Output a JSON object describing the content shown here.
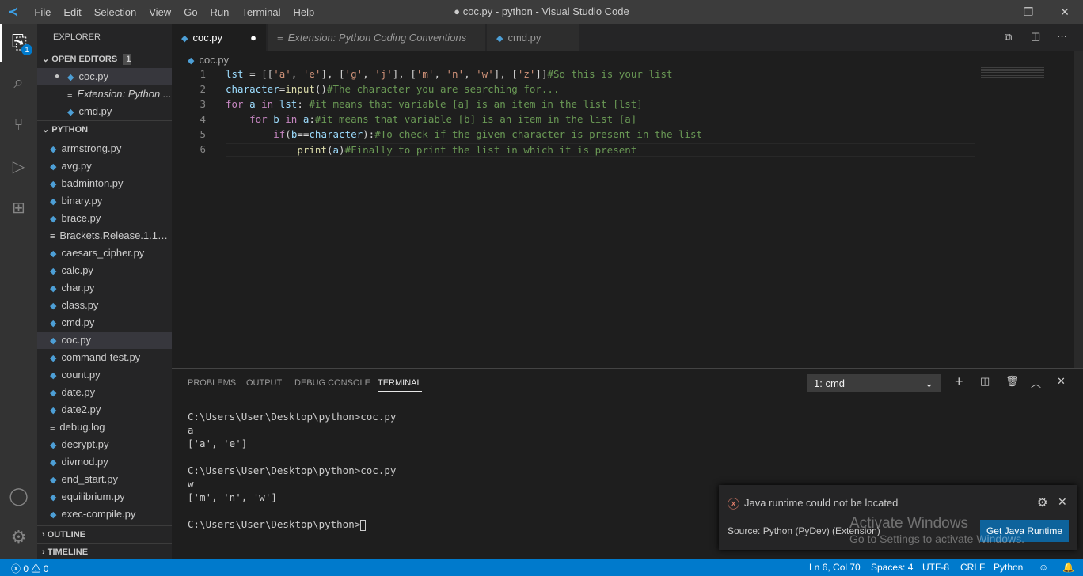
{
  "titlebar": {
    "menus": [
      "File",
      "Edit",
      "Selection",
      "View",
      "Go",
      "Run",
      "Terminal",
      "Help"
    ],
    "title": "● coc.py - python - Visual Studio Code"
  },
  "activity": {
    "explorer_badge": "1"
  },
  "sidebar": {
    "header": "EXPLORER",
    "open_editors": "OPEN EDITORS",
    "unsaved": "1 UNSAVED",
    "open_files": [
      {
        "name": "coc.py",
        "dirty": true,
        "type": "py"
      },
      {
        "name": "Extension: Python ...",
        "type": "ext"
      },
      {
        "name": "cmd.py",
        "type": "py"
      }
    ],
    "folder": "PYTHON",
    "files": [
      {
        "name": "armstrong.py",
        "type": "py"
      },
      {
        "name": "avg.py",
        "type": "py"
      },
      {
        "name": "badminton.py",
        "type": "py"
      },
      {
        "name": "binary.py",
        "type": "py"
      },
      {
        "name": "brace.py",
        "type": "py"
      },
      {
        "name": "Brackets.Release.1.14....",
        "type": "txt"
      },
      {
        "name": "caesars_cipher.py",
        "type": "py"
      },
      {
        "name": "calc.py",
        "type": "py"
      },
      {
        "name": "char.py",
        "type": "py"
      },
      {
        "name": "class.py",
        "type": "py"
      },
      {
        "name": "cmd.py",
        "type": "py"
      },
      {
        "name": "coc.py",
        "type": "py",
        "selected": true
      },
      {
        "name": "command-test.py",
        "type": "py"
      },
      {
        "name": "count.py",
        "type": "py"
      },
      {
        "name": "date.py",
        "type": "py"
      },
      {
        "name": "date2.py",
        "type": "py"
      },
      {
        "name": "debug.log",
        "type": "txt"
      },
      {
        "name": "decrypt.py",
        "type": "py"
      },
      {
        "name": "divmod.py",
        "type": "py"
      },
      {
        "name": "end_start.py",
        "type": "py"
      },
      {
        "name": "equilibrium.py",
        "type": "py"
      },
      {
        "name": "exec-compile.py",
        "type": "py"
      }
    ],
    "outline": "OUTLINE",
    "timeline": "TIMELINE"
  },
  "tabs": [
    {
      "label": "coc.py",
      "active": true,
      "dirty": true
    },
    {
      "label": "Extension: Python Coding Conventions",
      "italic": true
    },
    {
      "label": "cmd.py"
    }
  ],
  "breadcrumb": "coc.py",
  "colors": {
    "keyword": "#c586c0",
    "var": "#9cdcfe",
    "func": "#dcdcaa",
    "string": "#ce9178",
    "comment": "#6a9955",
    "plain": "#d4d4d4"
  },
  "code": [
    [
      [
        "lst",
        "var"
      ],
      [
        " = [[",
        "plain"
      ],
      [
        "'a'",
        "string"
      ],
      [
        ", ",
        "plain"
      ],
      [
        "'e'",
        "string"
      ],
      [
        "], [",
        "plain"
      ],
      [
        "'g'",
        "string"
      ],
      [
        ", ",
        "plain"
      ],
      [
        "'j'",
        "string"
      ],
      [
        "], [",
        "plain"
      ],
      [
        "'m'",
        "string"
      ],
      [
        ", ",
        "plain"
      ],
      [
        "'n'",
        "string"
      ],
      [
        ", ",
        "plain"
      ],
      [
        "'w'",
        "string"
      ],
      [
        "], [",
        "plain"
      ],
      [
        "'z'",
        "string"
      ],
      [
        "]]",
        "plain"
      ],
      [
        "#So this is your list",
        "comment"
      ]
    ],
    [
      [
        "character",
        "var"
      ],
      [
        "=",
        "plain"
      ],
      [
        "input",
        "func"
      ],
      [
        "()",
        "plain"
      ],
      [
        "#The character you are searching for...",
        "comment"
      ]
    ],
    [
      [
        "for",
        "keyword"
      ],
      [
        " a ",
        "var"
      ],
      [
        "in",
        "keyword"
      ],
      [
        " lst",
        "var"
      ],
      [
        ": ",
        "plain"
      ],
      [
        "#it means that variable [a] is an item in the list [lst]",
        "comment"
      ]
    ],
    [
      [
        "    ",
        "plain"
      ],
      [
        "for",
        "keyword"
      ],
      [
        " b ",
        "var"
      ],
      [
        "in",
        "keyword"
      ],
      [
        " a",
        "var"
      ],
      [
        ":",
        "plain"
      ],
      [
        "#it means that variable [b] is an item in the list [a]",
        "comment"
      ]
    ],
    [
      [
        "        ",
        "plain"
      ],
      [
        "if",
        "keyword"
      ],
      [
        "(",
        "plain"
      ],
      [
        "b",
        "var"
      ],
      [
        "==",
        "plain"
      ],
      [
        "character",
        "var"
      ],
      [
        "):",
        "plain"
      ],
      [
        "#To check if the given character is present in the list",
        "comment"
      ]
    ],
    [
      [
        "            ",
        "plain"
      ],
      [
        "print",
        "func"
      ],
      [
        "(",
        "plain"
      ],
      [
        "a",
        "var"
      ],
      [
        ")",
        "plain"
      ],
      [
        "#Finally to print the list in which it is present",
        "comment"
      ]
    ]
  ],
  "panel": {
    "tabs": [
      "PROBLEMS",
      "OUTPUT",
      "DEBUG CONSOLE",
      "TERMINAL"
    ],
    "active": "TERMINAL",
    "terminal_select": "1: cmd",
    "terminal_lines": [
      "C:\\Users\\User\\Desktop\\python>coc.py",
      "a",
      "['a', 'e']",
      "",
      "C:\\Users\\User\\Desktop\\python>coc.py",
      "w",
      "['m', 'n', 'w']",
      "",
      "C:\\Users\\User\\Desktop\\python>"
    ]
  },
  "notification": {
    "message": "Java runtime could not be located",
    "source": "Source: Python (PyDev) (Extension)",
    "button": "Get Java Runtime"
  },
  "watermark": {
    "line1": "Activate Windows",
    "line2": "Go to Settings to activate Windows."
  },
  "status": {
    "errors": "0",
    "warnings": "0",
    "position": "Ln 6, Col 70",
    "spaces": "Spaces: 4",
    "encoding": "UTF-8",
    "eol": "CRLF",
    "language": "Python"
  }
}
